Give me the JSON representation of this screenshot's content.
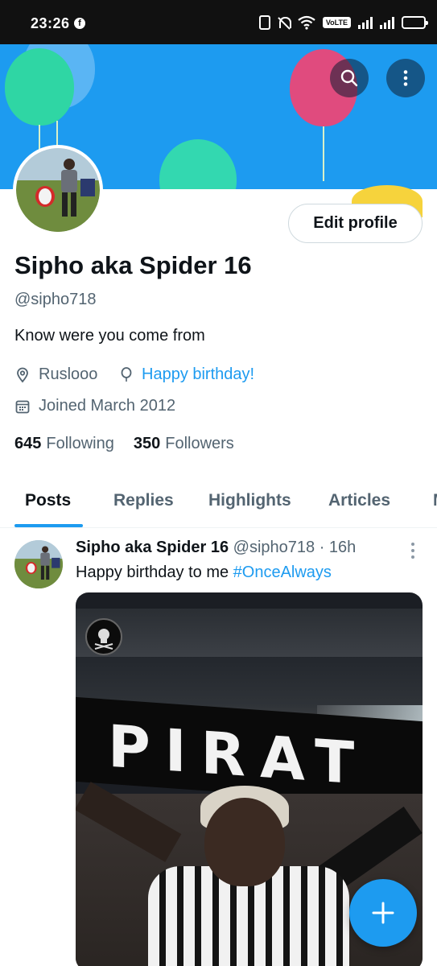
{
  "status_bar": {
    "time": "23:26",
    "network_label": "VoLTE",
    "battery_level": 0.85,
    "icons": [
      "facebook-icon",
      "nfc-icon",
      "bell-off-icon",
      "wifi-icon",
      "volte-icon",
      "signal-icon",
      "signal-icon",
      "battery-icon"
    ]
  },
  "header": {
    "search_icon": "search-icon",
    "more_icon": "more-vertical-icon",
    "banner_color": "#1d9bf0"
  },
  "profile": {
    "edit_label": "Edit profile",
    "display_name": "Sipho aka Spider 16",
    "handle": "@sipho718",
    "bio": "Know were you come from",
    "location": "Ruslooo",
    "birthday": "Happy birthday!",
    "joined": "Joined March 2012",
    "following_count": "645",
    "following_label": "Following",
    "followers_count": "350",
    "followers_label": "Followers"
  },
  "tabs": [
    {
      "label": "Posts",
      "active": true
    },
    {
      "label": "Replies",
      "active": false
    },
    {
      "label": "Highlights",
      "active": false
    },
    {
      "label": "Articles",
      "active": false
    },
    {
      "label": "M",
      "active": false
    }
  ],
  "post": {
    "name": "Sipho aka Spider 16",
    "handle": "@sipho718",
    "time": "· 16h",
    "text": "Happy birthday to me ",
    "hashtag": "#OnceAlways",
    "media_scarf_text": "PIRAT"
  },
  "colors": {
    "accent": "#1d9bf0",
    "text_primary": "#0f1419",
    "text_secondary": "#536471"
  },
  "fab": {
    "icon": "plus-icon"
  }
}
